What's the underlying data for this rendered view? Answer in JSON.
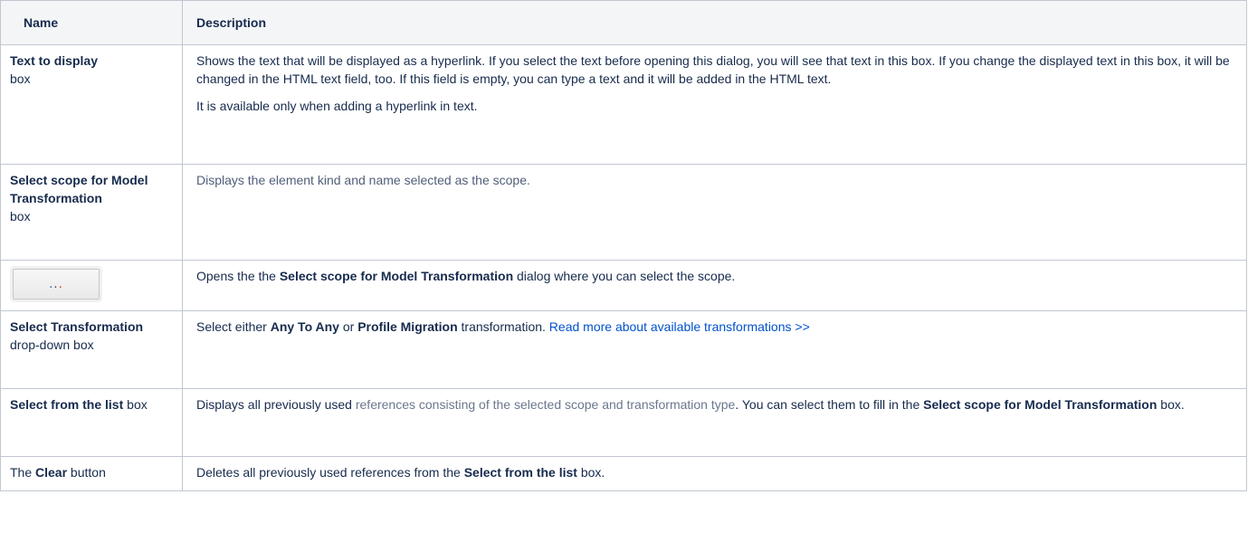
{
  "table": {
    "headers": {
      "name": "Name",
      "description": "Description"
    },
    "rows": {
      "text_to_display": {
        "name_bold": "Text to display",
        "name_suffix": "box",
        "desc_p1": "Shows the text that will be displayed as a hyperlink. If you select the text before opening this dialog, you will see that text in this box. If you change the displayed text in this box, it will be changed in the HTML text field, too. If this field is empty, you can type a text and it will be added in the HTML text.",
        "desc_p2": "It is available only when adding a hyperlink in text."
      },
      "select_scope": {
        "name_bold": "Select scope for Model Transformation",
        "name_suffix": "box",
        "desc": "Displays the element kind and name selected as the scope."
      },
      "ellipsis": {
        "button_label": "...",
        "desc_pre": "Opens the the ",
        "desc_bold": "Select scope for Model Transformation",
        "desc_post": " dialog where you can select the scope."
      },
      "select_transformation": {
        "name_bold": "Select Transformation",
        "name_suffix": "drop-down box",
        "desc_pre": "Select either ",
        "desc_bold1": "Any To Any",
        "desc_mid": " or ",
        "desc_bold2": "Profile Migration",
        "desc_post": " transformation. ",
        "link_text": "Read more about available transformations >>"
      },
      "select_from_list": {
        "name_bold": "Select from the list",
        "name_suffix": " box",
        "desc_pre": "Displays all previously used ",
        "desc_muted": "references consisting of the selected scope and transformation type",
        "desc_mid": ". You can select them to fill in the ",
        "desc_bold": "Select scope for Model Transformation",
        "desc_post": " box."
      },
      "clear": {
        "name_pre": "The ",
        "name_bold": "Clear",
        "name_post": " button",
        "desc_pre": "Deletes all previously used references from the ",
        "desc_bold": "Select from the list",
        "desc_post": " box."
      }
    }
  }
}
